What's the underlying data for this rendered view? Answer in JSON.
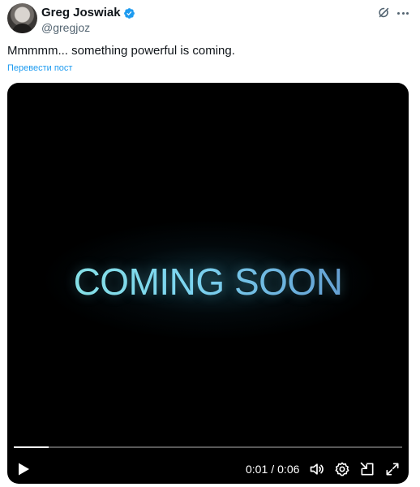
{
  "author": {
    "display_name": "Greg Joswiak",
    "handle": "@gregjoz",
    "verified_badge_color": "#1d9bf0"
  },
  "post": {
    "text": "Mmmmm... something powerful is coming.",
    "translate_label": "Перевести пост"
  },
  "video": {
    "overlay_text": "COMING SOON",
    "current_time": "0:01",
    "separator": "/",
    "duration": "0:06",
    "progress_fraction": 0.09
  },
  "icons": {
    "grok": "grok-icon",
    "more": "more-icon",
    "play": "play-icon",
    "volume": "volume-icon",
    "settings": "settings-icon",
    "pip": "picture-in-picture-icon",
    "fullscreen": "fullscreen-icon"
  },
  "colors": {
    "link": "#1d9bf0",
    "secondary_text": "#536471",
    "primary_text": "#0f1419"
  }
}
